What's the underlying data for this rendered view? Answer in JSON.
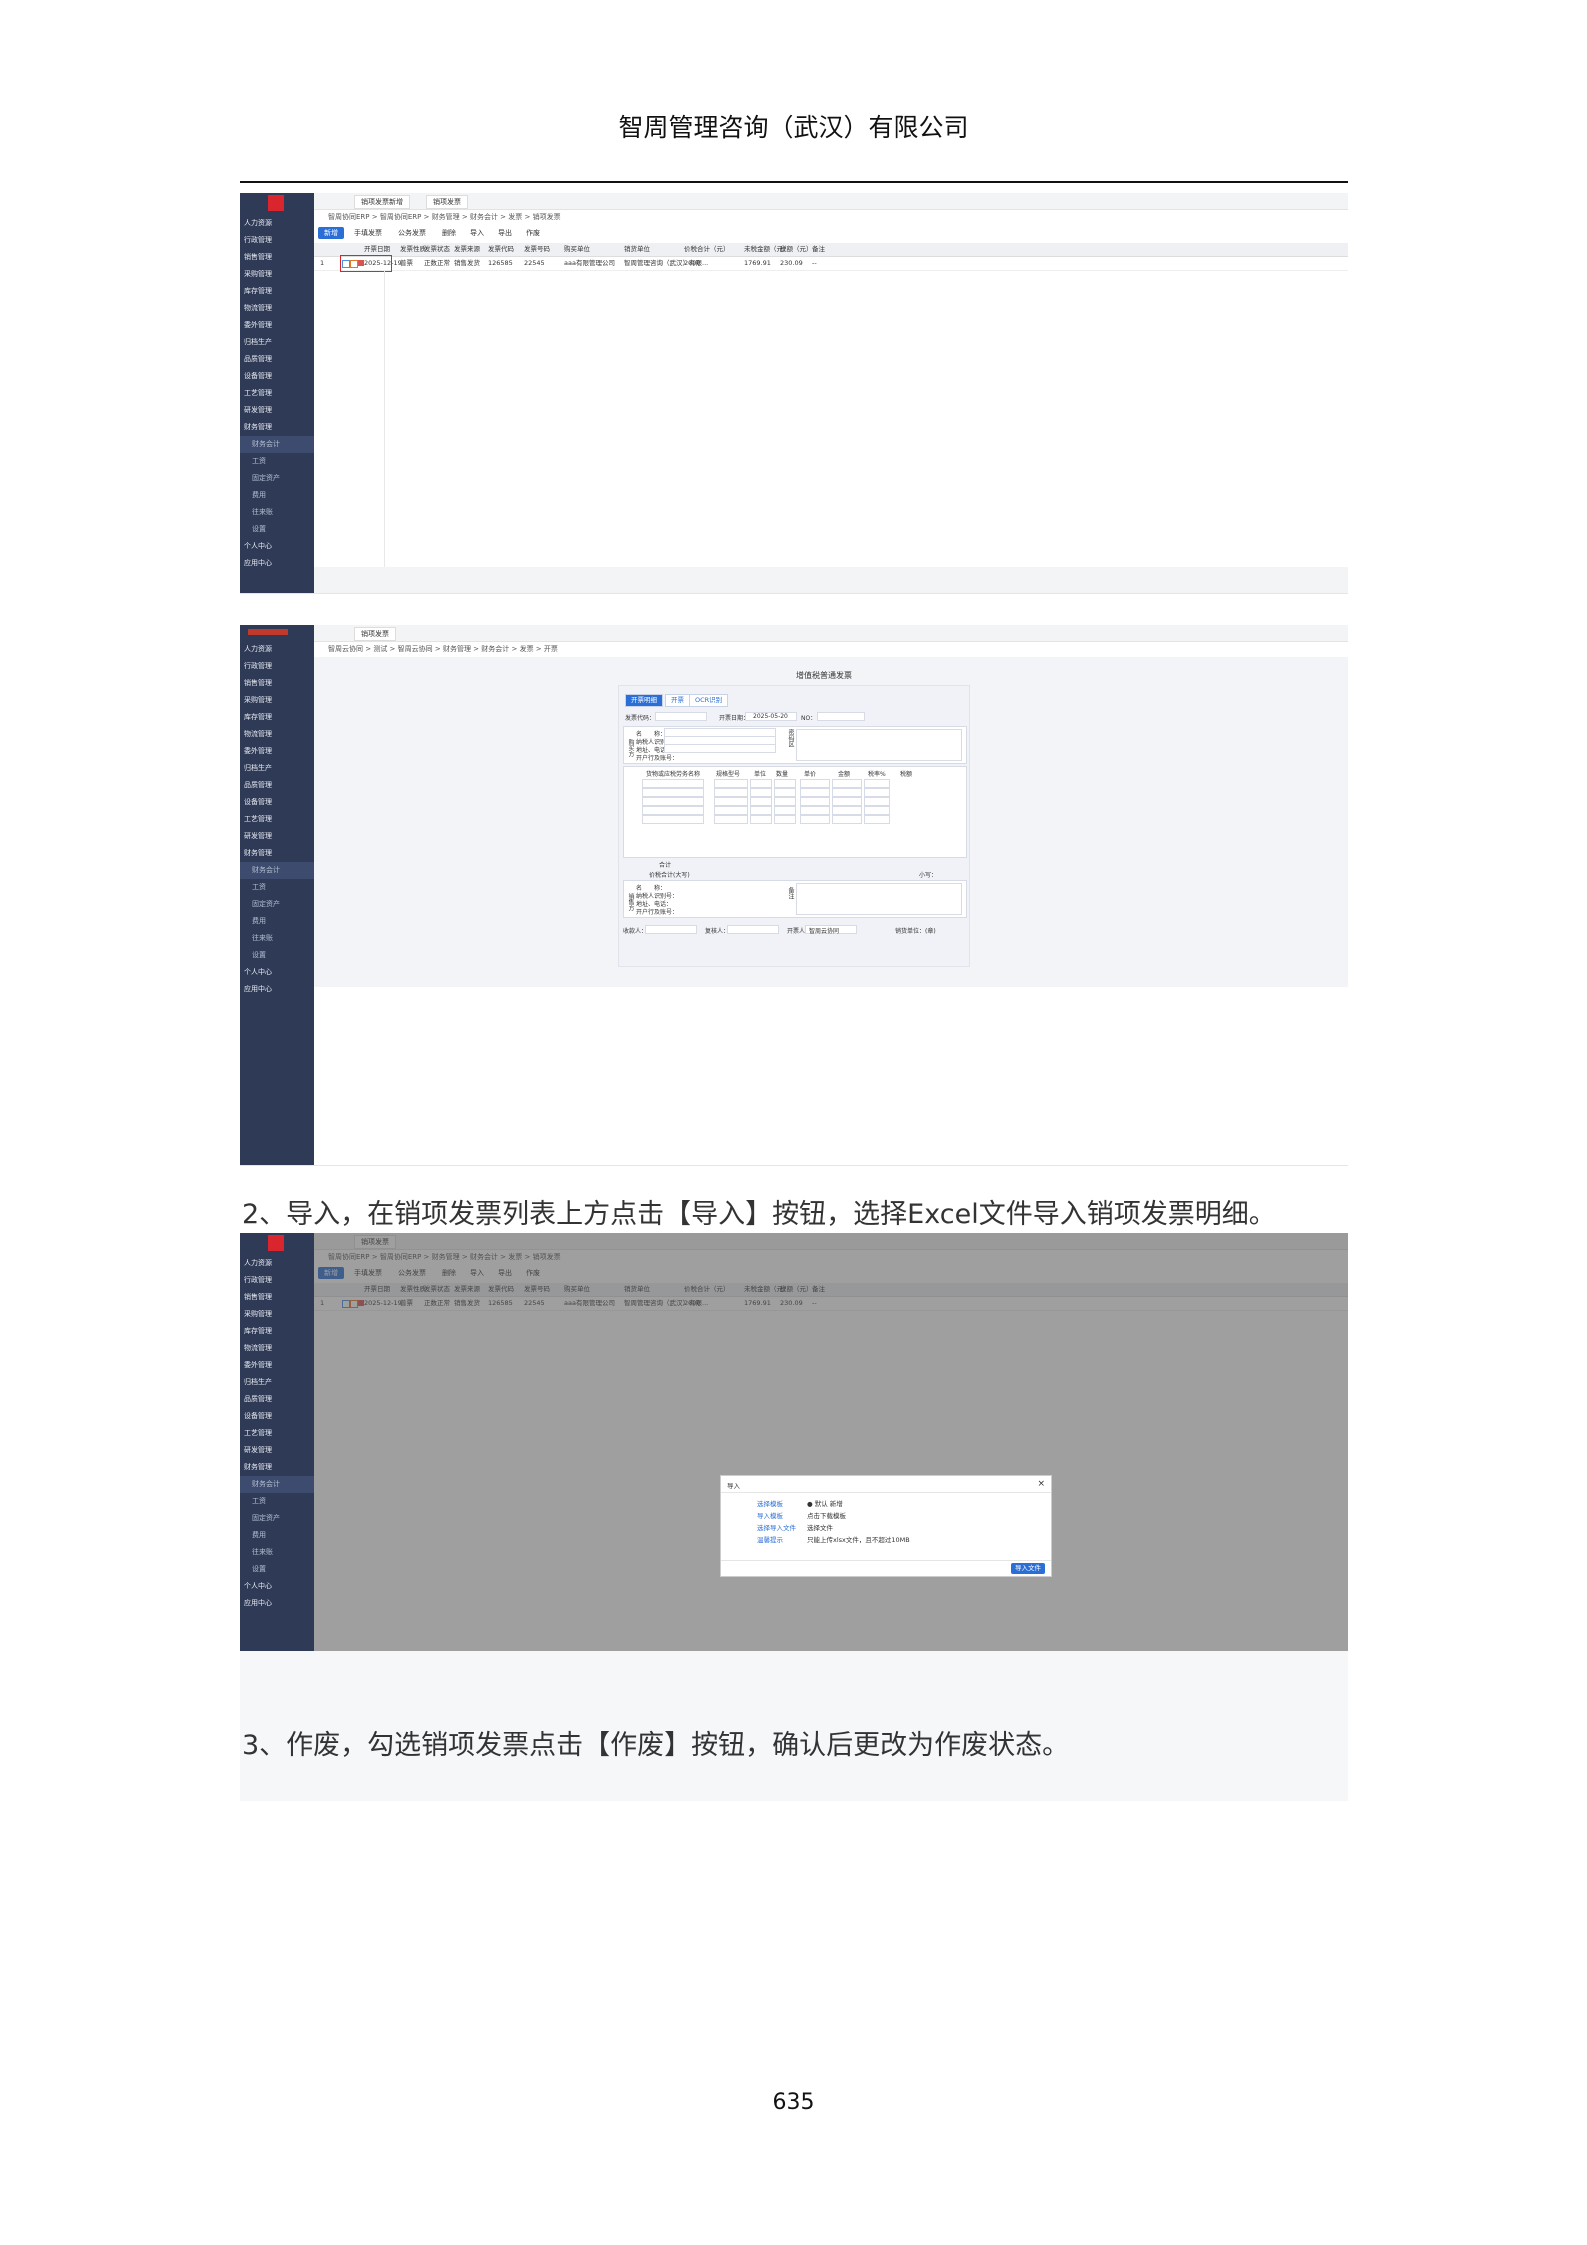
{
  "header": {
    "title": "智周管理咨询（武汉）有限公司"
  },
  "page_number": "635",
  "captions": {
    "step2": "2、导入，在销项发票列表上方点击【导入】按钮，选择Excel文件导入销项发票明细。",
    "step3": "3、作废，勾选销项发票点击【作废】按钮，确认后更改为作废状态。"
  },
  "sidebar_items": [
    "人力资源",
    "行政管理",
    "销售管理",
    "采购管理",
    "库存管理",
    "物流管理",
    "委外管理",
    "归档生产",
    "品质管理",
    "设备管理",
    "工艺管理",
    "研发管理",
    "财务管理"
  ],
  "sidebar_sub": [
    "财务会计",
    "工资",
    "固定资产",
    "费用",
    "往来账",
    "设置"
  ],
  "sidebar_tail": [
    "个人中心",
    "应用中心"
  ],
  "shot1": {
    "tabs": [
      "销项发票新增",
      "销项发票"
    ],
    "breadcrumb": "智周协同ERP > 智周协同ERP > 财务管理 > 财务会计 > 发票 > 销项发票",
    "toolbar": [
      "新增",
      "手填发票",
      "公务发票",
      "删除",
      "导入",
      "导出",
      "作废"
    ],
    "headers": [
      "开票日期",
      "发票性质",
      "发票状态",
      "发票来源",
      "发票代码",
      "发票号码",
      "购买单位",
      "销货单位",
      "价税合计（元）",
      "未税金额（元）",
      "税额（元）",
      "备注"
    ],
    "row": [
      "1",
      "2025-12-19",
      "普票",
      "正数正常",
      "销售发货",
      "126585",
      "22545",
      "aaa有限管理公司",
      "智周管理咨询（武汉）有限...",
      "2000",
      "1769.91",
      "230.09",
      "--"
    ]
  },
  "shot2": {
    "tab": "销项发票",
    "breadcrumb": "智周云协同 > 测试 > 智周云协同 > 财务管理 > 财务会计 > 发票 > 开票",
    "form_title": "增值税普通发票",
    "form_tabs": [
      "开票明细",
      "开票",
      "OCR识别"
    ],
    "fields": {
      "code": "发票代码：",
      "date_label": "开票日期：",
      "date_value": "2025-05-20",
      "no": "NO：",
      "buyer": "购买方",
      "name": "名　　称：",
      "taxno": "纳税人识别号：",
      "addr": "地址、电话：",
      "bank": "开户行及账号：",
      "pwd": "密码区",
      "item": "货物或应税劳务名称",
      "spec": "规格型号",
      "unit": "单位",
      "qty": "数量",
      "price": "单价",
      "amount": "金额",
      "rate": "税率%",
      "tax": "税额",
      "total": "合计",
      "total_cn": "价税合计(大写)",
      "small": "小写：",
      "seller": "销售方",
      "remark": "备注",
      "payee": "收款人：",
      "reviewer": "复核人：",
      "drawer": "开票人：",
      "drawer_name": "智周云协同",
      "stamp": "销货单位：(章)"
    }
  },
  "shot3": {
    "modal_title": "导入",
    "rows": [
      {
        "label": "选择模板",
        "value": "● 默认  新增"
      },
      {
        "label": "导入模板",
        "value": "点击下载模板"
      },
      {
        "label": "选择导入文件",
        "value": "选择文件"
      },
      {
        "label": "温馨提示",
        "value": "只能上传xlsx文件，且不超过10MB"
      }
    ],
    "confirm": "导入文件"
  }
}
